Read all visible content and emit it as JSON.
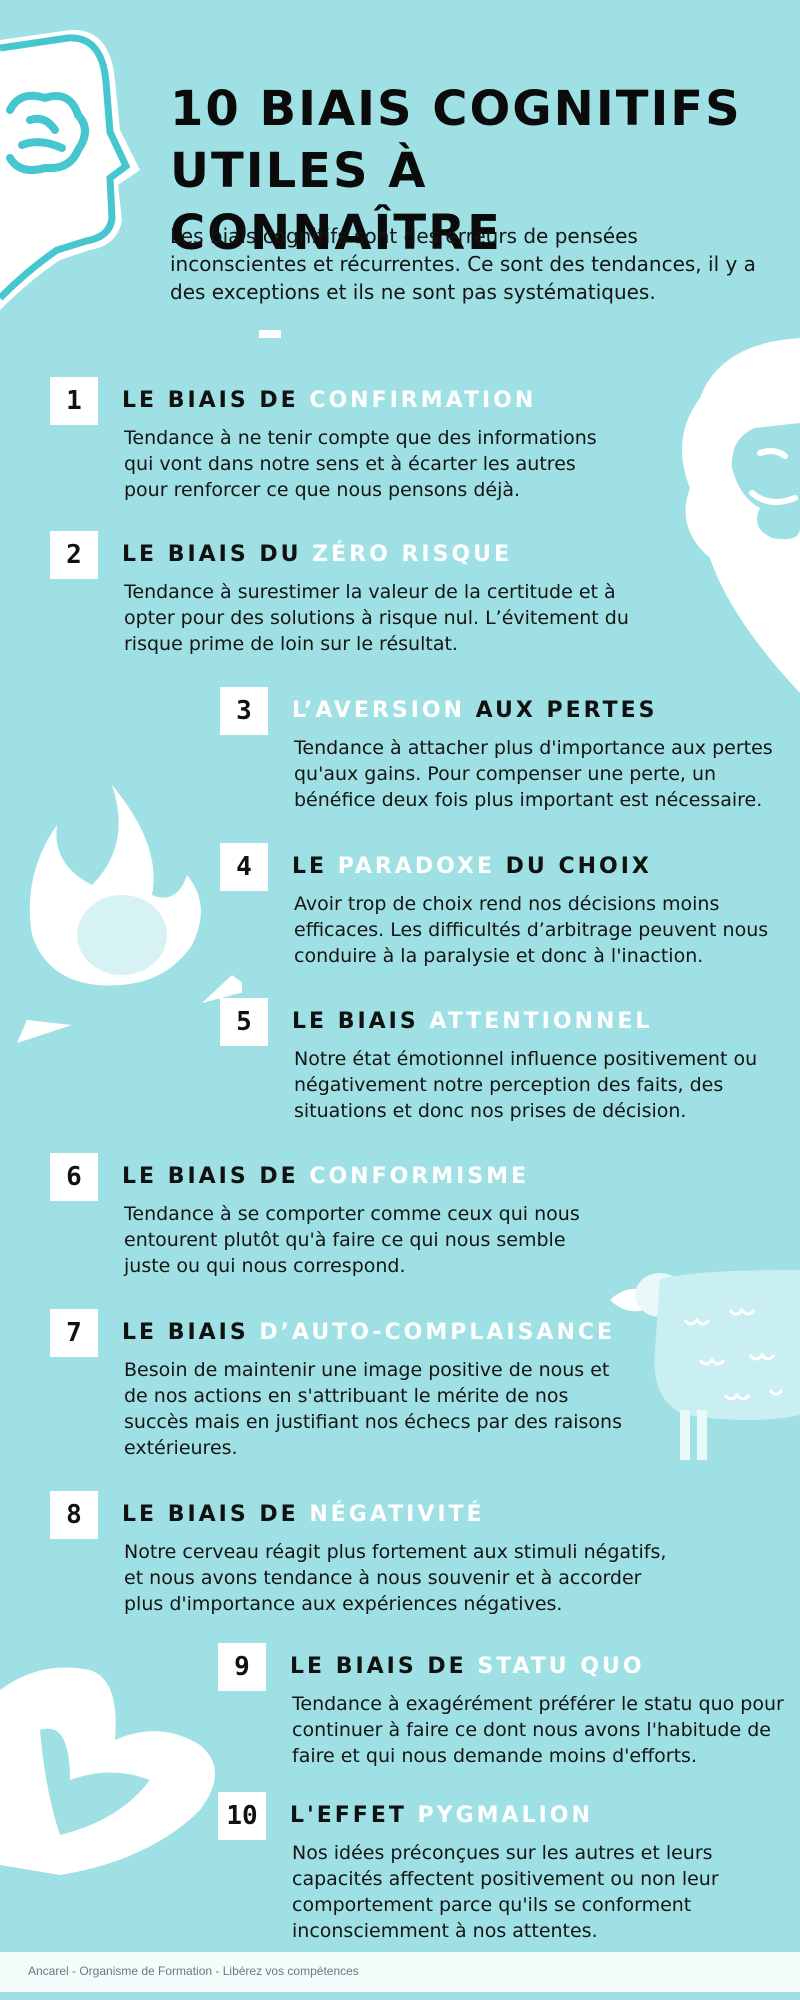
{
  "colors": {
    "background": "#9ee0e4",
    "accent": "#ffffff",
    "text": "#111111"
  },
  "title": {
    "line1": "10 BIAIS COGNITIFS",
    "line2": "UTILES À CONNAÎTRE"
  },
  "intro": "Les biais cognitifs sont des erreurs de pensées inconscientes et récurrentes. Ce sont des tendances, il y a des exceptions et ils ne sont pas systématiques.",
  "biases": [
    {
      "number": "1",
      "dark1": "LE BIAIS DE ",
      "light": "CONFIRMATION",
      "dark2": "",
      "description": "Tendance à ne tenir compte que des informations qui vont dans notre sens et à écarter les autres pour renforcer ce que nous pensons déjà."
    },
    {
      "number": "2",
      "dark1": "LE BIAIS DU ",
      "light": "ZÉRO RISQUE",
      "dark2": "",
      "description": "Tendance à surestimer la valeur de la certitude et à opter pour des solutions à risque nul. L’évitement du risque prime de loin sur le résultat."
    },
    {
      "number": "3",
      "dark1": "",
      "light": "L’AVERSION ",
      "dark2": "AUX PERTES",
      "description": "Tendance à attacher plus d'importance aux pertes qu'aux gains. Pour compenser une perte, un bénéfice deux fois plus important est nécessaire."
    },
    {
      "number": "4",
      "dark1": "LE ",
      "light": "PARADOXE ",
      "dark2": "DU CHOIX",
      "description": "Avoir trop de choix rend nos décisions moins efficaces. Les difficultés d’arbitrage peuvent nous conduire à la paralysie et donc à l'inaction."
    },
    {
      "number": "5",
      "dark1": "LE BIAIS ",
      "light": "ATTENTIONNEL",
      "dark2": "",
      "description": "Notre état émotionnel influence positivement ou négativement notre perception des faits, des situations et donc nos prises de décision."
    },
    {
      "number": "6",
      "dark1": "LE BIAIS DE ",
      "light": "CONFORMISME",
      "dark2": "",
      "description": "Tendance à se comporter comme ceux qui nous entourent plutôt qu'à faire ce qui nous semble juste ou qui nous correspond."
    },
    {
      "number": "7",
      "dark1": "LE BIAIS ",
      "light": "D’AUTO-COMPLAISANCE",
      "dark2": "",
      "description": "Besoin de maintenir une image positive de nous et de nos actions en s'attribuant le mérite de nos succès mais en justifiant nos échecs par des raisons extérieures."
    },
    {
      "number": "8",
      "dark1": "LE BIAIS DE ",
      "light": "NÉGATIVITÉ",
      "dark2": "",
      "description": "Notre cerveau réagit plus fortement aux stimuli négatifs, et nous avons tendance à nous souvenir et à accorder plus d'importance aux expériences négatives."
    },
    {
      "number": "9",
      "dark1": "LE BIAIS DE ",
      "light": "STATU QUO",
      "dark2": "",
      "description": "Tendance à exagérément préférer le statu quo pour continuer à faire ce dont nous avons l'habitude de faire et qui nous demande moins d'efforts."
    },
    {
      "number": "10",
      "dark1": "L'EFFET ",
      "light": "PYGMALION",
      "dark2": "",
      "description": "Nos idées préconçues sur les autres et leurs capacités affectent positivement ou non leur comportement parce qu'ils se conforment inconsciemment à nos attentes."
    }
  ],
  "footer": "Ancarel - Organisme de Formation - Libérez vos compétences"
}
